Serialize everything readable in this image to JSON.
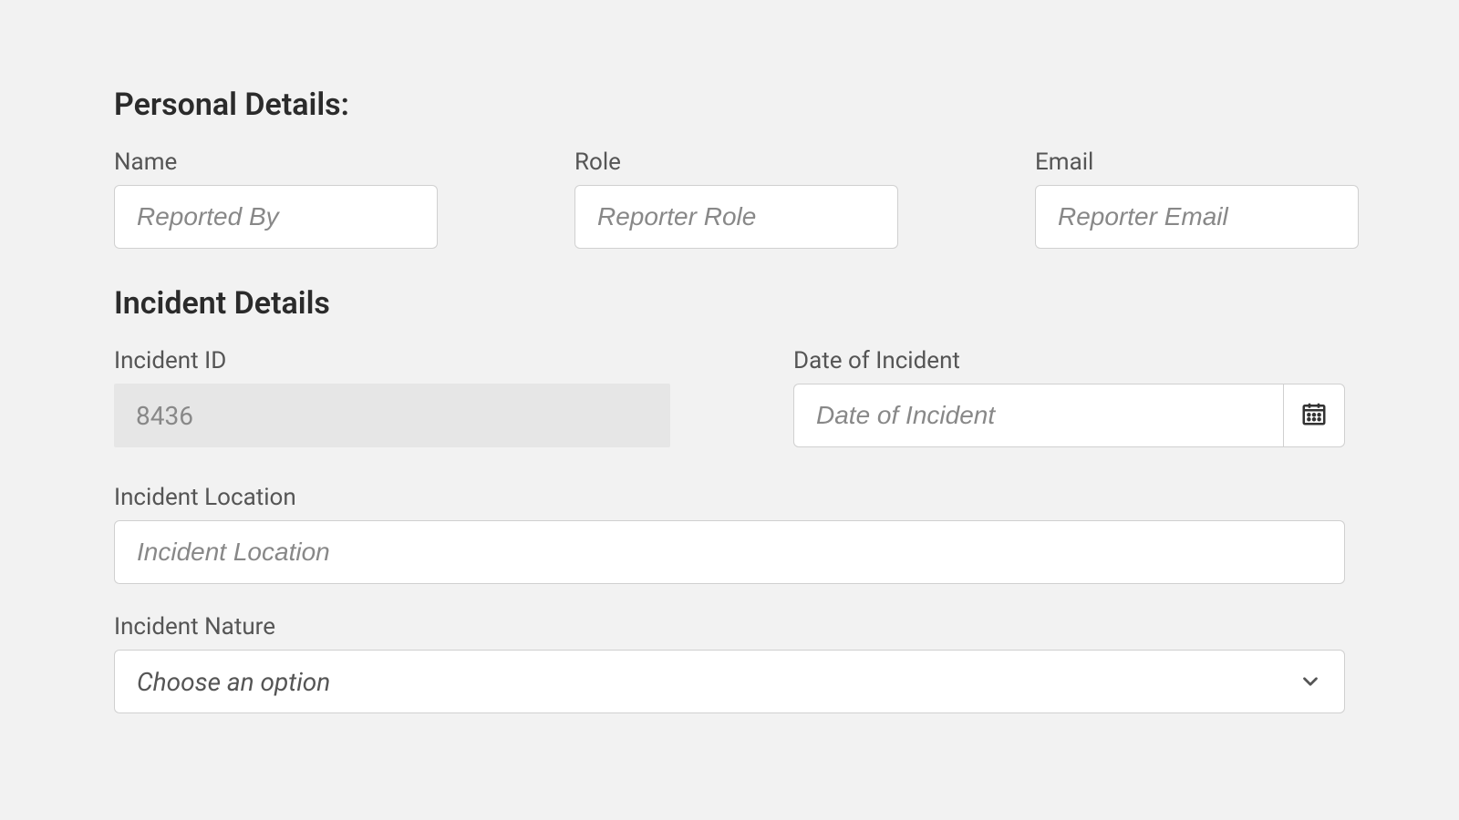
{
  "personal": {
    "title": "Personal Details:",
    "name": {
      "label": "Name",
      "placeholder": "Reported By"
    },
    "role": {
      "label": "Role",
      "placeholder": "Reporter Role"
    },
    "email": {
      "label": "Email",
      "placeholder": "Reporter Email"
    }
  },
  "incident": {
    "title": "Incident Details",
    "id": {
      "label": "Incident ID",
      "value": "8436"
    },
    "date": {
      "label": "Date of Incident",
      "placeholder": "Date of Incident"
    },
    "location": {
      "label": "Incident Location",
      "placeholder": "Incident Location"
    },
    "nature": {
      "label": "Incident Nature",
      "placeholder": "Choose an option"
    }
  }
}
